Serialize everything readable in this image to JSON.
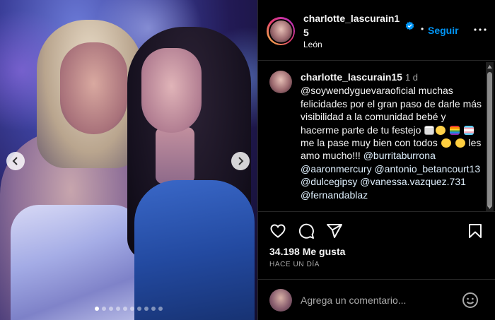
{
  "post": {
    "author": "charlotte_lascurain15",
    "location": "León",
    "follow_label": "Seguir",
    "bullet": "•",
    "caption": {
      "username": "charlotte_lascurain15",
      "time": "1 d",
      "line1": "@soywendyguevaraoficial muchas felicidades por el gran paso de darle más visibilidad a la comunidad bebé y hacerme parte de tu festejo",
      "line2": "me la pase muy bien con todos",
      "line3": "les amo mucho!!!",
      "mentions": [
        "@burritaburrona",
        "@aaronmercury",
        "@antonio_betancourt13",
        "@dulcegipsy",
        "@vanessa.vazquez.731",
        "@fernandablaz"
      ]
    },
    "likes": "34.198 Me gusta",
    "time_ago": "HACE UN DÍA",
    "comment_placeholder": "Agrega un comentario...",
    "carousel": {
      "total": 10,
      "active_index": 0
    }
  },
  "colors": {
    "accent": "#0095f6",
    "background": "#000000",
    "secondary_text": "#a8a8a8"
  },
  "icons": [
    "verified-badge-icon",
    "more-options-icon",
    "heart-icon",
    "comment-icon",
    "share-icon",
    "bookmark-icon",
    "emoji-icon",
    "chevron-left-icon",
    "chevron-right-icon"
  ]
}
